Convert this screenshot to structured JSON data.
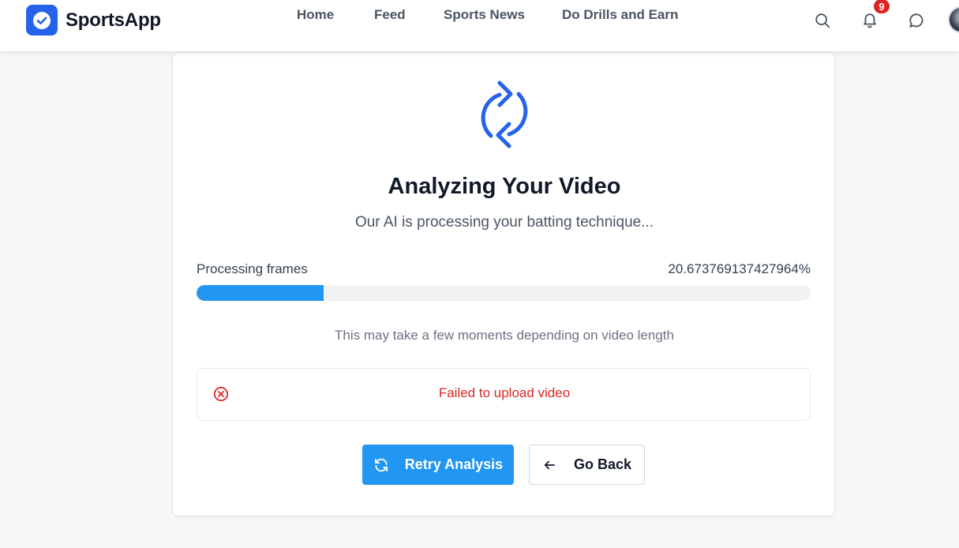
{
  "header": {
    "brand": "SportsApp",
    "nav": [
      {
        "label": "Home"
      },
      {
        "label": "Feed"
      },
      {
        "label": "Sports News"
      },
      {
        "label": "Do Drills and Earn"
      }
    ],
    "icons": [
      "search-icon",
      "bell-icon",
      "chat-icon",
      "avatar"
    ],
    "notification_count": "9"
  },
  "main": {
    "title": "Analyzing Your Video",
    "subtitle": "Our AI is processing your batting technique...",
    "progress": {
      "label": "Processing frames",
      "value_text": "20.673769137427964%",
      "percent": 20.673769137427964
    },
    "hint": "This may take a few moments depending on video length",
    "error_message": "Failed to upload video",
    "retry_label": "Retry Analysis",
    "back_label": "Go Back"
  },
  "colors": {
    "brand": "#2563eb",
    "accent": "#2196f3",
    "error": "#dc2626",
    "badge": "#dc2626"
  }
}
